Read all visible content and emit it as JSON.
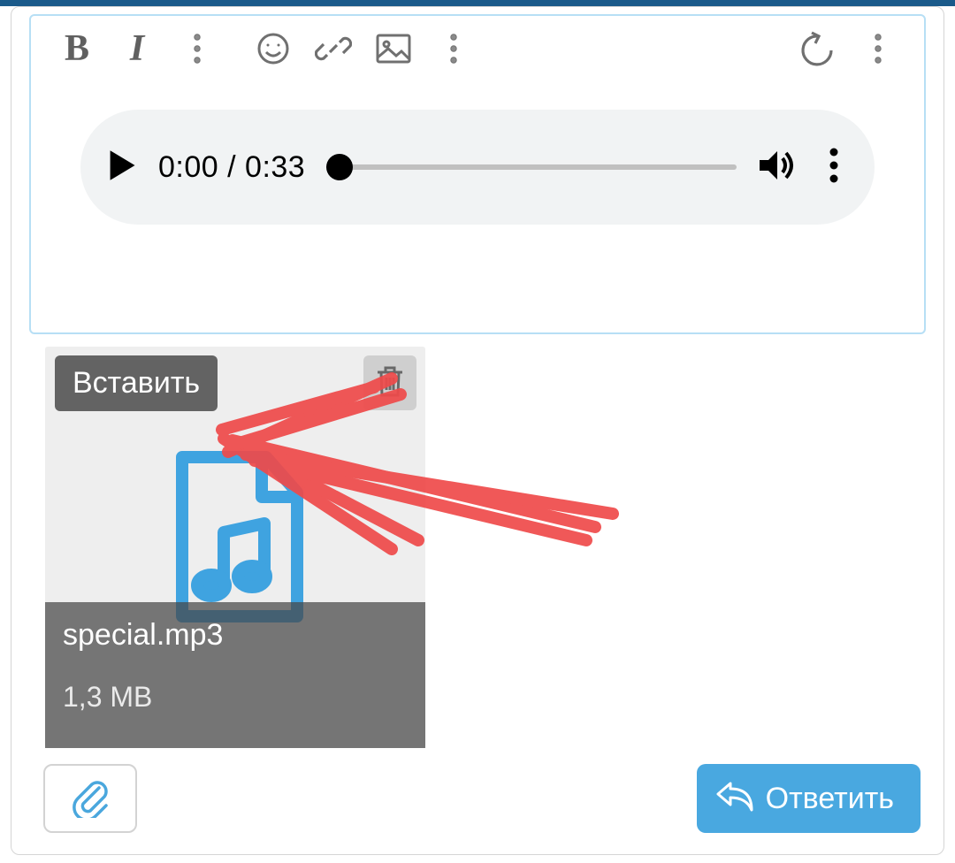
{
  "audio": {
    "current_time": "0:00",
    "duration": "0:33"
  },
  "attachment": {
    "insert_label": "Вставить",
    "file_name": "special.mp3",
    "file_size": "1,3 MB"
  },
  "actions": {
    "reply_label": "Ответить"
  }
}
